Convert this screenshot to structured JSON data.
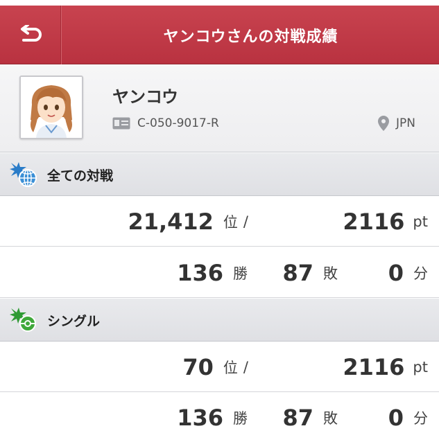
{
  "header": {
    "title": "ヤンコウさんの対戦成績",
    "back_icon": "back-arrow-icon"
  },
  "profile": {
    "name": "ヤンコウ",
    "player_id": "C-050-9017-R",
    "location": "JPN",
    "id_icon": "id-card-icon",
    "location_icon": "location-pin-icon"
  },
  "sections": [
    {
      "title": "全ての対戦",
      "icon": "globe-battle-icon",
      "rank": "21,412",
      "rank_unit": "位",
      "separator": "/",
      "points": "2116",
      "points_unit": "pt",
      "wins": "136",
      "wins_unit": "勝",
      "losses": "87",
      "losses_unit": "敗",
      "draws": "0",
      "draws_unit": "分"
    },
    {
      "title": "シングル",
      "icon": "single-battle-icon",
      "rank": "70",
      "rank_unit": "位",
      "separator": "/",
      "points": "2116",
      "points_unit": "pt",
      "wins": "136",
      "wins_unit": "勝",
      "losses": "87",
      "losses_unit": "敗",
      "draws": "0",
      "draws_unit": "分"
    }
  ],
  "colors": {
    "header_red": "#c13a47",
    "section_bg": "#e4e5e8",
    "globe_blue": "#3a8fd6",
    "ball_green": "#3fa83a"
  }
}
